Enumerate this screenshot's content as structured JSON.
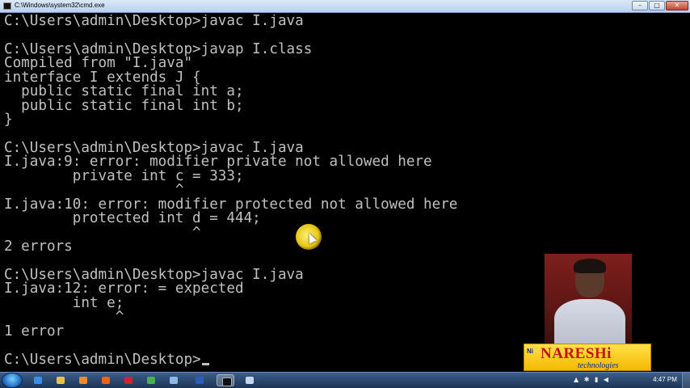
{
  "window": {
    "title": "C:\\Windows\\system32\\cmd.exe",
    "min_label": "–",
    "max_label": "□",
    "close_label": "✕"
  },
  "console": {
    "lines": [
      "C:\\Users\\admin\\Desktop>javac I.java",
      "",
      "C:\\Users\\admin\\Desktop>javap I.class",
      "Compiled from \"I.java\"",
      "interface I extends J {",
      "  public static final int a;",
      "  public static final int b;",
      "}",
      "",
      "C:\\Users\\admin\\Desktop>javac I.java",
      "I.java:9: error: modifier private not allowed here",
      "        private int c = 333;",
      "                    ^",
      "I.java:10: error: modifier protected not allowed here",
      "        protected int d = 444;",
      "                      ^",
      "2 errors",
      "",
      "C:\\Users\\admin\\Desktop>javac I.java",
      "I.java:12: error: = expected",
      "        int e;",
      "             ^",
      "1 error",
      "",
      "C:\\Users\\admin\\Desktop>"
    ]
  },
  "logo": {
    "prefix": "Ni",
    "main": "NARESHi",
    "sub": "technologies"
  },
  "taskbar": {
    "apps": [
      {
        "icon": "ie-icon",
        "color": "#3b8ee8"
      },
      {
        "icon": "folder-icon",
        "color": "#e9c24a"
      },
      {
        "icon": "media-player-icon",
        "color": "#f08a2a"
      },
      {
        "icon": "firefox-icon",
        "color": "#e8661c"
      },
      {
        "icon": "opera-icon",
        "color": "#d3222a"
      },
      {
        "icon": "chrome-icon",
        "color": "#4cae4c"
      },
      {
        "icon": "explorer-icon",
        "color": "#8fb8e6"
      },
      {
        "icon": "word-icon",
        "color": "#2a5cb8"
      },
      {
        "icon": "cmd-icon",
        "color": "#111111"
      },
      {
        "icon": "paint-icon",
        "color": "#c3d6ee"
      }
    ],
    "tray": "▲ ✱ ▮ ◀",
    "clock": "4:47 PM"
  }
}
